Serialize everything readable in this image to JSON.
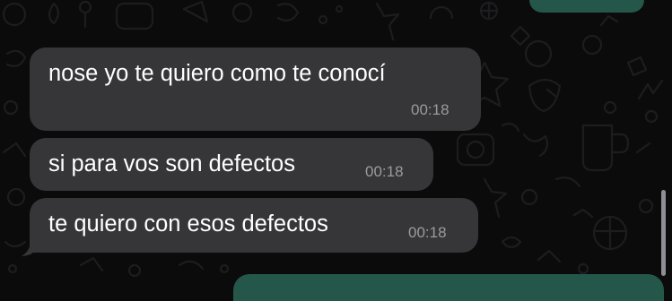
{
  "conversation": {
    "incoming": [
      {
        "text": "nose yo te quiero como te conocí",
        "time": "00:18"
      },
      {
        "text": "si para vos son defectos",
        "time": "00:18"
      },
      {
        "text": "te quiero con esos defectos",
        "time": "00:18"
      }
    ]
  },
  "colors": {
    "background": "#0b0b0b",
    "incoming_bubble": "#363638",
    "outgoing_bubble": "#24574a",
    "timestamp": "#9b9b9f",
    "doodle_stroke": "#1c1c1e"
  }
}
